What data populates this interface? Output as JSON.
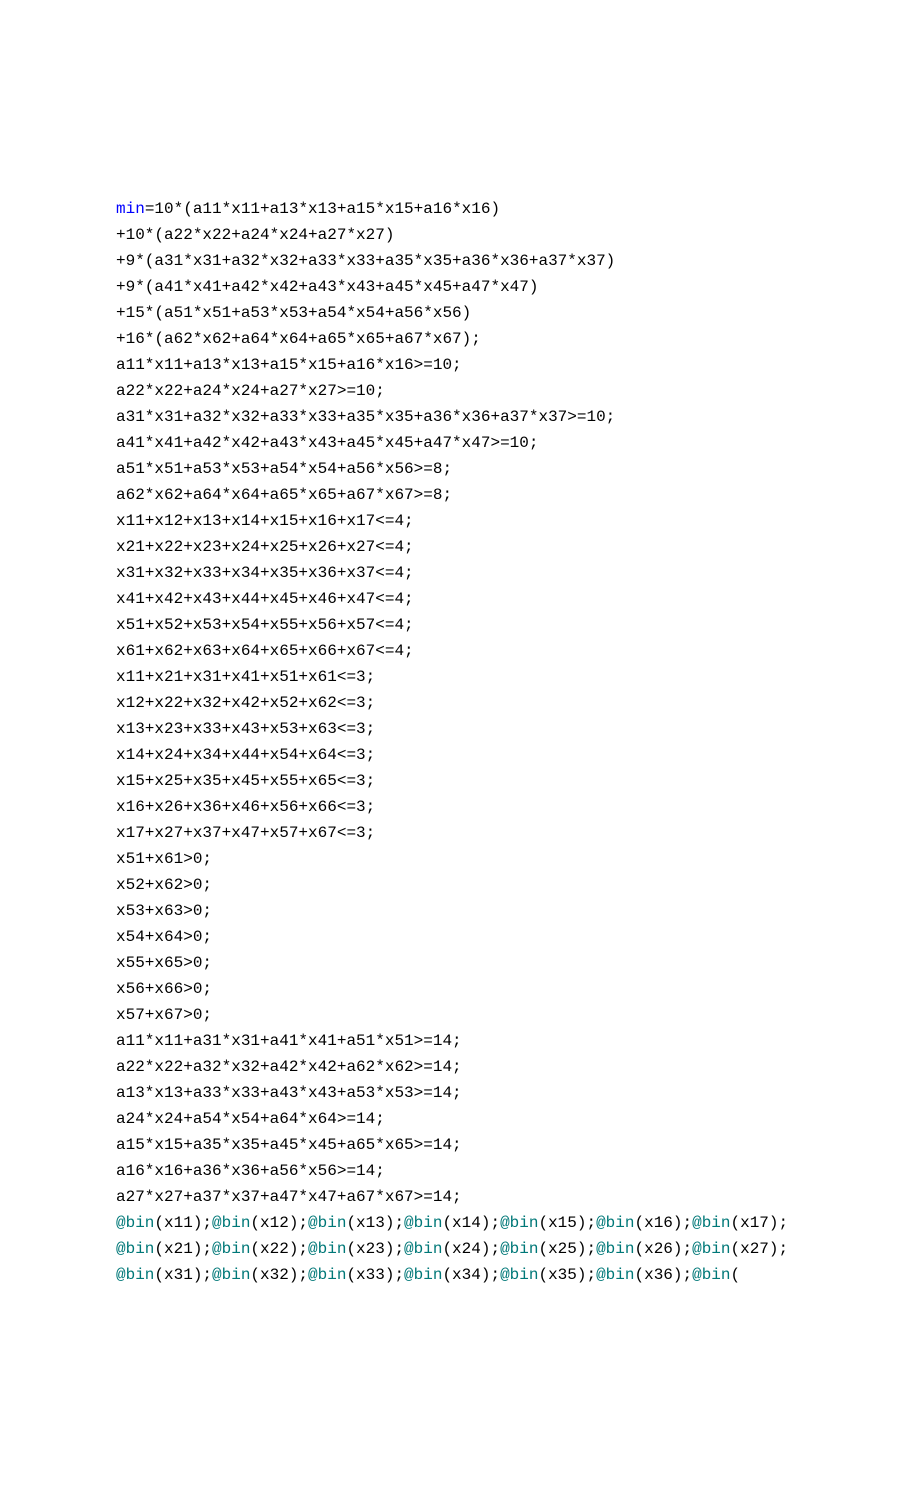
{
  "tokens": [
    {
      "t": "min",
      "c": "kw"
    },
    {
      "t": "=10*(a11*x11+a13*x13+a15*x15+a16*x16)",
      "c": "txt"
    },
    {
      "t": "\n"
    },
    {
      "t": "+10*(a22*x22+a24*x24+a27*x27)",
      "c": "txt"
    },
    {
      "t": "\n"
    },
    {
      "t": "+9*(a31*x31+a32*x32+a33*x33+a35*x35+a36*x36+a37*x37)",
      "c": "txt"
    },
    {
      "t": "\n"
    },
    {
      "t": "+9*(a41*x41+a42*x42+a43*x43+a45*x45+a47*x47)",
      "c": "txt"
    },
    {
      "t": "\n"
    },
    {
      "t": "+15*(a51*x51+a53*x53+a54*x54+a56*x56)",
      "c": "txt"
    },
    {
      "t": "\n"
    },
    {
      "t": "+16*(a62*x62+a64*x64+a65*x65+a67*x67);",
      "c": "txt"
    },
    {
      "t": "\n"
    },
    {
      "t": "a11*x11+a13*x13+a15*x15+a16*x16>=10;",
      "c": "txt"
    },
    {
      "t": "\n"
    },
    {
      "t": "a22*x22+a24*x24+a27*x27>=10;",
      "c": "txt"
    },
    {
      "t": "\n"
    },
    {
      "t": "a31*x31+a32*x32+a33*x33+a35*x35+a36*x36+a37*x37>=10;",
      "c": "txt"
    },
    {
      "t": "\n"
    },
    {
      "t": "a41*x41+a42*x42+a43*x43+a45*x45+a47*x47>=10;",
      "c": "txt"
    },
    {
      "t": "\n"
    },
    {
      "t": "a51*x51+a53*x53+a54*x54+a56*x56>=8;",
      "c": "txt"
    },
    {
      "t": "\n"
    },
    {
      "t": "a62*x62+a64*x64+a65*x65+a67*x67>=8;",
      "c": "txt"
    },
    {
      "t": "\n"
    },
    {
      "t": "x11+x12+x13+x14+x15+x16+x17<=4;",
      "c": "txt"
    },
    {
      "t": "\n"
    },
    {
      "t": "x21+x22+x23+x24+x25+x26+x27<=4;",
      "c": "txt"
    },
    {
      "t": "\n"
    },
    {
      "t": "x31+x32+x33+x34+x35+x36+x37<=4;",
      "c": "txt"
    },
    {
      "t": "\n"
    },
    {
      "t": "x41+x42+x43+x44+x45+x46+x47<=4;",
      "c": "txt"
    },
    {
      "t": "\n"
    },
    {
      "t": "x51+x52+x53+x54+x55+x56+x57<=4;",
      "c": "txt"
    },
    {
      "t": "\n"
    },
    {
      "t": "x61+x62+x63+x64+x65+x66+x67<=4;",
      "c": "txt"
    },
    {
      "t": "\n"
    },
    {
      "t": "x11+x21+x31+x41+x51+x61<=3;",
      "c": "txt"
    },
    {
      "t": "\n"
    },
    {
      "t": "x12+x22+x32+x42+x52+x62<=3;",
      "c": "txt"
    },
    {
      "t": "\n"
    },
    {
      "t": "x13+x23+x33+x43+x53+x63<=3;",
      "c": "txt"
    },
    {
      "t": "\n"
    },
    {
      "t": "x14+x24+x34+x44+x54+x64<=3;",
      "c": "txt"
    },
    {
      "t": "\n"
    },
    {
      "t": "x15+x25+x35+x45+x55+x65<=3;",
      "c": "txt"
    },
    {
      "t": "\n"
    },
    {
      "t": "x16+x26+x36+x46+x56+x66<=3;",
      "c": "txt"
    },
    {
      "t": "\n"
    },
    {
      "t": "x17+x27+x37+x47+x57+x67<=3;",
      "c": "txt"
    },
    {
      "t": "\n"
    },
    {
      "t": "x51+x61>0;",
      "c": "txt"
    },
    {
      "t": "\n"
    },
    {
      "t": "x52+x62>0;",
      "c": "txt"
    },
    {
      "t": "\n"
    },
    {
      "t": "x53+x63>0;",
      "c": "txt"
    },
    {
      "t": "\n"
    },
    {
      "t": "x54+x64>0;",
      "c": "txt"
    },
    {
      "t": "\n"
    },
    {
      "t": "x55+x65>0;",
      "c": "txt"
    },
    {
      "t": "\n"
    },
    {
      "t": "x56+x66>0;",
      "c": "txt"
    },
    {
      "t": "\n"
    },
    {
      "t": "x57+x67>0;",
      "c": "txt"
    },
    {
      "t": "\n"
    },
    {
      "t": "a11*x11+a31*x31+a41*x41+a51*x51>=14;",
      "c": "txt"
    },
    {
      "t": "\n"
    },
    {
      "t": "a22*x22+a32*x32+a42*x42+a62*x62>=14;",
      "c": "txt"
    },
    {
      "t": "\n"
    },
    {
      "t": "a13*x13+a33*x33+a43*x43+a53*x53>=14;",
      "c": "txt"
    },
    {
      "t": "\n"
    },
    {
      "t": "a24*x24+a54*x54+a64*x64>=14;",
      "c": "txt"
    },
    {
      "t": "\n"
    },
    {
      "t": "a15*x15+a35*x35+a45*x45+a65*x65>=14;",
      "c": "txt"
    },
    {
      "t": "\n"
    },
    {
      "t": "a16*x16+a36*x36+a56*x56>=14;",
      "c": "txt"
    },
    {
      "t": "\n"
    },
    {
      "t": "a27*x27+a37*x37+a47*x47+a67*x67>=14;",
      "c": "txt"
    },
    {
      "t": "\n"
    },
    {
      "t": "@bin",
      "c": "fn"
    },
    {
      "t": "(x11);",
      "c": "txt"
    },
    {
      "t": "@bin",
      "c": "fn"
    },
    {
      "t": "(x12);",
      "c": "txt"
    },
    {
      "t": "@bin",
      "c": "fn"
    },
    {
      "t": "(x13);",
      "c": "txt"
    },
    {
      "t": "@bin",
      "c": "fn"
    },
    {
      "t": "(x14);",
      "c": "txt"
    },
    {
      "t": "@bin",
      "c": "fn"
    },
    {
      "t": "(x15);",
      "c": "txt"
    },
    {
      "t": "@bin",
      "c": "fn"
    },
    {
      "t": "(x16);",
      "c": "txt"
    },
    {
      "t": "@bin",
      "c": "fn"
    },
    {
      "t": "(x17);",
      "c": "txt"
    },
    {
      "t": "\n"
    },
    {
      "t": "@bin",
      "c": "fn"
    },
    {
      "t": "(x21);",
      "c": "txt"
    },
    {
      "t": "@bin",
      "c": "fn"
    },
    {
      "t": "(x22);",
      "c": "txt"
    },
    {
      "t": "@bin",
      "c": "fn"
    },
    {
      "t": "(x23);",
      "c": "txt"
    },
    {
      "t": "@bin",
      "c": "fn"
    },
    {
      "t": "(x24);",
      "c": "txt"
    },
    {
      "t": "@bin",
      "c": "fn"
    },
    {
      "t": "(x25);",
      "c": "txt"
    },
    {
      "t": "@bin",
      "c": "fn"
    },
    {
      "t": "(x26);",
      "c": "txt"
    },
    {
      "t": "@bin",
      "c": "fn"
    },
    {
      "t": "(x27);",
      "c": "txt"
    },
    {
      "t": "\n"
    },
    {
      "t": "@bin",
      "c": "fn"
    },
    {
      "t": "(x31);",
      "c": "txt"
    },
    {
      "t": "@bin",
      "c": "fn"
    },
    {
      "t": "(x32);",
      "c": "txt"
    },
    {
      "t": "@bin",
      "c": "fn"
    },
    {
      "t": "(x33);",
      "c": "txt"
    },
    {
      "t": "@bin",
      "c": "fn"
    },
    {
      "t": "(x34);",
      "c": "txt"
    },
    {
      "t": "@bin",
      "c": "fn"
    },
    {
      "t": "(x35);",
      "c": "txt"
    },
    {
      "t": "@bin",
      "c": "fn"
    },
    {
      "t": "(x36);",
      "c": "txt"
    },
    {
      "t": "@bin",
      "c": "fn"
    },
    {
      "t": "(",
      "c": "txt"
    }
  ]
}
